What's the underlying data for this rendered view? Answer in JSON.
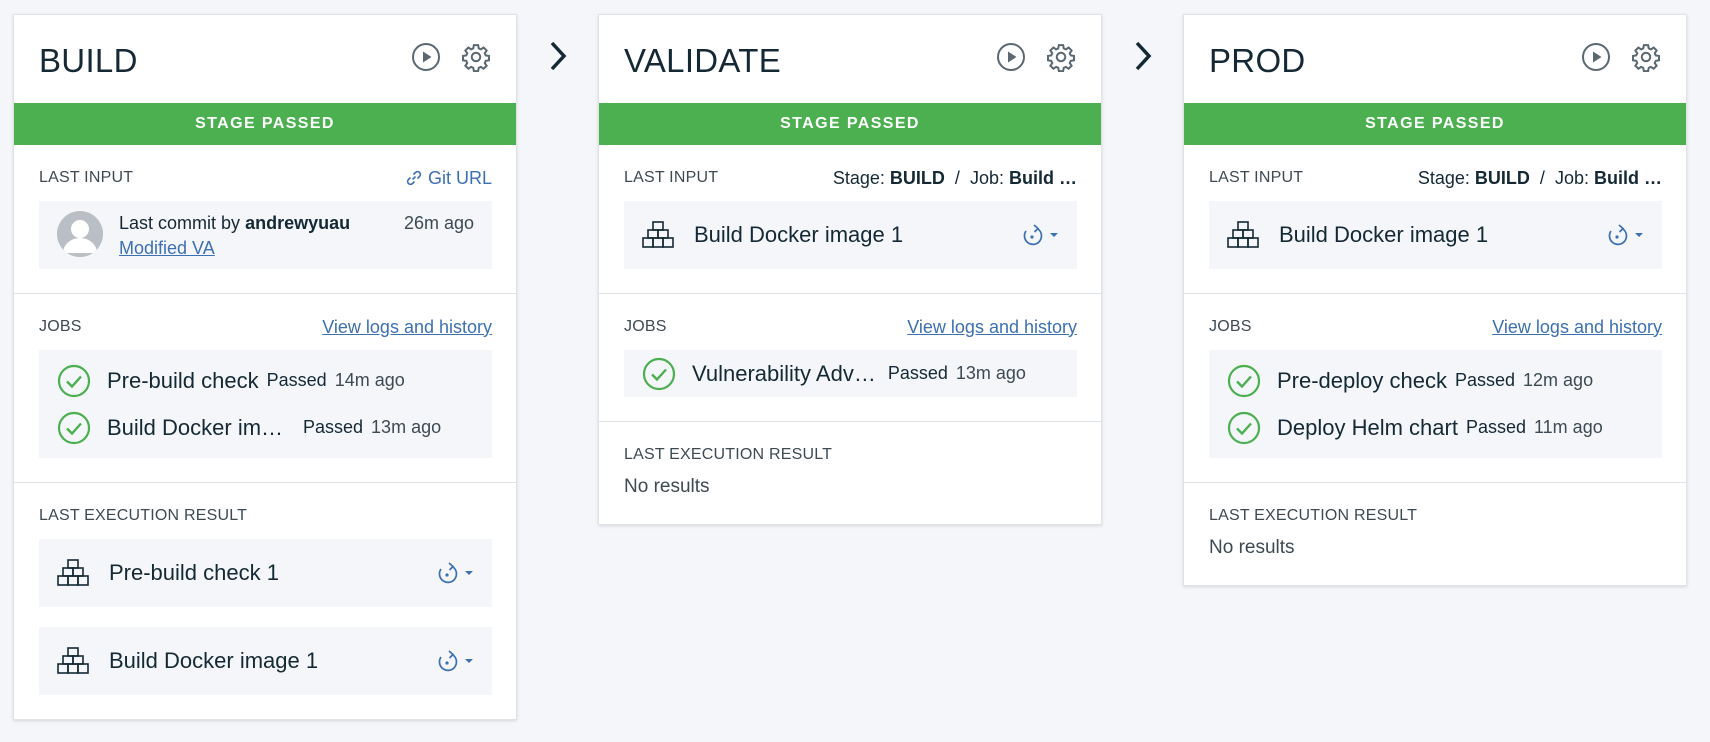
{
  "colors": {
    "passed": "#4caf50",
    "link": "#3d70b2",
    "text": "#152935"
  },
  "stages": [
    {
      "title": "BUILD",
      "status": "STAGE PASSED",
      "last_input": {
        "label": "LAST INPUT",
        "git_link": "Git URL",
        "commit_prefix": "Last commit by",
        "author": "andrewyuau",
        "message": "Modified VA",
        "time": "26m ago"
      },
      "jobs": {
        "label": "JOBS",
        "link": "View logs and history",
        "items": [
          {
            "name": "Pre-build check",
            "status": "Passed",
            "time": "14m ago"
          },
          {
            "name": "Build Docker image",
            "display": "Build Docker im…",
            "status": "Passed",
            "time": "13m ago"
          }
        ]
      },
      "result": {
        "label": "LAST EXECUTION RESULT",
        "items": [
          "Pre-build check 1",
          "Build Docker image 1"
        ]
      }
    },
    {
      "title": "VALIDATE",
      "status": "STAGE PASSED",
      "last_input": {
        "label": "LAST INPUT",
        "stage_prefix": "Stage:",
        "stage": "BUILD",
        "sep": "/",
        "job_prefix": "Job:",
        "job": "Build …",
        "artifact": "Build Docker image 1"
      },
      "jobs": {
        "label": "JOBS",
        "link": "View logs and history",
        "items": [
          {
            "name": "Vulnerability Adv…",
            "status": "Passed",
            "time": "13m ago"
          }
        ]
      },
      "result": {
        "label": "LAST EXECUTION RESULT",
        "empty": "No results"
      }
    },
    {
      "title": "PROD",
      "status": "STAGE PASSED",
      "last_input": {
        "label": "LAST INPUT",
        "stage_prefix": "Stage:",
        "stage": "BUILD",
        "sep": "/",
        "job_prefix": "Job:",
        "job": "Build …",
        "artifact": "Build Docker image 1"
      },
      "jobs": {
        "label": "JOBS",
        "link": "View logs and history",
        "items": [
          {
            "name": "Pre-deploy check",
            "status": "Passed",
            "time": "12m ago"
          },
          {
            "name": "Deploy Helm chart",
            "status": "Passed",
            "time": "11m ago"
          }
        ]
      },
      "result": {
        "label": "LAST EXECUTION RESULT",
        "empty": "No results"
      }
    }
  ]
}
